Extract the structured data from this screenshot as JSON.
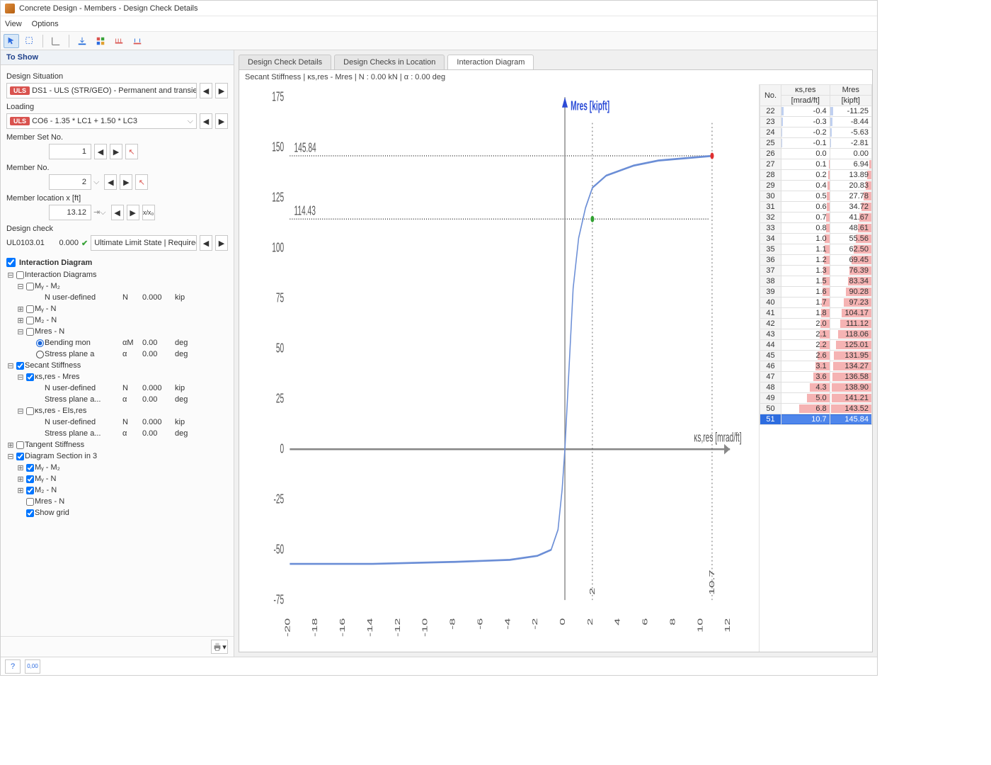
{
  "window_title": "Concrete Design - Members - Design Check Details",
  "menu": {
    "view": "View",
    "options": "Options"
  },
  "sidebar": {
    "header": "To Show",
    "design_situation_lbl": "Design Situation",
    "design_situation_badge": "ULS",
    "design_situation_val": "DS1 - ULS (STR/GEO) - Permanent and transient - E...",
    "loading_lbl": "Loading",
    "loading_badge": "ULS",
    "loading_val": "CO6 - 1.35 * LC1 + 1.50 * LC3",
    "member_set_lbl": "Member Set No.",
    "member_set_val": "1",
    "member_no_lbl": "Member No.",
    "member_no_val": "2",
    "member_loc_lbl": "Member location x [ft]",
    "member_loc_val": "13.12",
    "design_check_lbl": "Design check",
    "design_check_code": "UL0103.01",
    "design_check_ratio": "0.000",
    "design_check_desc": "Ultimate Limit State | Required...",
    "interaction_chk": "Interaction Diagram",
    "tree": [
      {
        "lvl": 0,
        "tw": "−",
        "ck": "u",
        "t1": "Interaction Diagrams"
      },
      {
        "lvl": 1,
        "tw": "−",
        "ck": "u",
        "t1": "Mᵧ - M₂"
      },
      {
        "lvl": 2,
        "tw": "",
        "ck": "",
        "t1": "N user-defined",
        "c2": "N",
        "c3": "0.000",
        "c4": "kip"
      },
      {
        "lvl": 1,
        "tw": "+",
        "ck": "u",
        "t1": "Mᵧ - N"
      },
      {
        "lvl": 1,
        "tw": "+",
        "ck": "u",
        "t1": "M₂ - N"
      },
      {
        "lvl": 1,
        "tw": "−",
        "ck": "u",
        "t1": "Mres - N"
      },
      {
        "lvl": 2,
        "tw": "",
        "ck": "r1",
        "t1": "Bending mon",
        "c2": "αM",
        "c3": "0.00",
        "c4": "deg"
      },
      {
        "lvl": 2,
        "tw": "",
        "ck": "r0",
        "t1": "Stress plane a",
        "c2": "α",
        "c3": "0.00",
        "c4": "deg"
      },
      {
        "lvl": 0,
        "tw": "−",
        "ck": "c",
        "t1": "Secant Stiffness"
      },
      {
        "lvl": 1,
        "tw": "−",
        "ck": "c",
        "t1": "κs,res - Mres"
      },
      {
        "lvl": 2,
        "tw": "",
        "ck": "",
        "t1": "N user-defined",
        "c2": "N",
        "c3": "0.000",
        "c4": "kip"
      },
      {
        "lvl": 2,
        "tw": "",
        "ck": "",
        "t1": "Stress plane a...",
        "c2": "α",
        "c3": "0.00",
        "c4": "deg"
      },
      {
        "lvl": 1,
        "tw": "−",
        "ck": "u",
        "t1": "κs,res - EIs,res"
      },
      {
        "lvl": 2,
        "tw": "",
        "ck": "",
        "t1": "N user-defined",
        "c2": "N",
        "c3": "0.000",
        "c4": "kip"
      },
      {
        "lvl": 2,
        "tw": "",
        "ck": "",
        "t1": "Stress plane a...",
        "c2": "α",
        "c3": "0.00",
        "c4": "deg"
      },
      {
        "lvl": 0,
        "tw": "+",
        "ck": "u",
        "t1": "Tangent Stiffness"
      },
      {
        "lvl": 0,
        "tw": "−",
        "ck": "c",
        "t1": "Diagram Section in 3"
      },
      {
        "lvl": 1,
        "tw": "+",
        "ck": "c",
        "t1": "Mᵧ - M₂"
      },
      {
        "lvl": 1,
        "tw": "+",
        "ck": "c",
        "t1": "Mᵧ - N"
      },
      {
        "lvl": 1,
        "tw": "+",
        "ck": "c",
        "t1": "M₂ - N"
      },
      {
        "lvl": 1,
        "tw": "",
        "ck": "u",
        "t1": "Mres - N"
      },
      {
        "lvl": 1,
        "tw": "",
        "ck": "c",
        "t1": "Show grid"
      }
    ]
  },
  "tabs": {
    "t1": "Design Check Details",
    "t2": "Design Checks in Location",
    "t3": "Interaction Diagram"
  },
  "chart_caption": "Secant Stiffness | κs,res - Mres | N : 0.00 kN | α : 0.00 deg",
  "chart_data": {
    "type": "line",
    "xlabel": "κs,res [mrad/ft]",
    "ylabel": "Mres [kipft]",
    "xlim": [
      -20,
      12
    ],
    "ylim": [
      -75,
      175
    ],
    "xticks": [
      -20,
      -18,
      -16,
      -14,
      -12,
      -10,
      -8,
      -6,
      -4,
      -2,
      0,
      2,
      4,
      6,
      8,
      10,
      12
    ],
    "yticks": [
      -75,
      -50,
      -25,
      0,
      25,
      50,
      75,
      100,
      125,
      150,
      175
    ],
    "annotations": [
      {
        "y": 145.84,
        "txt": "145.84"
      },
      {
        "y": 114.43,
        "txt": "114.43"
      }
    ],
    "marks": {
      "x1": 2.0,
      "x2": 10.7
    },
    "series": [
      {
        "name": "κ-M",
        "values": [
          [
            -20,
            -57
          ],
          [
            -14,
            -57
          ],
          [
            -8,
            -56
          ],
          [
            -6,
            -55.5
          ],
          [
            -4,
            -55
          ],
          [
            -2,
            -53
          ],
          [
            -1,
            -50
          ],
          [
            -0.5,
            -40
          ],
          [
            -0.2,
            -20
          ],
          [
            0,
            0
          ],
          [
            0.3,
            40
          ],
          [
            0.6,
            80
          ],
          [
            1.0,
            105
          ],
          [
            1.5,
            120
          ],
          [
            2.0,
            130
          ],
          [
            3,
            136
          ],
          [
            5,
            141
          ],
          [
            6.8,
            143.5
          ],
          [
            10.7,
            145.8
          ]
        ]
      }
    ],
    "points": [
      {
        "x": 10.7,
        "y": 145.84,
        "cls": "pt-red"
      },
      {
        "x": 2.0,
        "y": 114.43,
        "cls": "pt-grn"
      }
    ]
  },
  "table": {
    "cols": {
      "no": "No.",
      "k": "κs,res",
      "ku": "[mrad/ft]",
      "m": "Mres",
      "mu": "[kipft]"
    },
    "rows": [
      {
        "no": 22,
        "k": -0.4,
        "m": -11.25
      },
      {
        "no": 23,
        "k": -0.3,
        "m": -8.44
      },
      {
        "no": 24,
        "k": -0.2,
        "m": -5.63
      },
      {
        "no": 25,
        "k": -0.1,
        "m": -2.81
      },
      {
        "no": 26,
        "k": 0.0,
        "m": 0.0
      },
      {
        "no": 27,
        "k": 0.1,
        "m": 6.94
      },
      {
        "no": 28,
        "k": 0.2,
        "m": 13.89
      },
      {
        "no": 29,
        "k": 0.4,
        "m": 20.83
      },
      {
        "no": 30,
        "k": 0.5,
        "m": 27.78
      },
      {
        "no": 31,
        "k": 0.6,
        "m": 34.72
      },
      {
        "no": 32,
        "k": 0.7,
        "m": 41.67
      },
      {
        "no": 33,
        "k": 0.8,
        "m": 48.61
      },
      {
        "no": 34,
        "k": 1.0,
        "m": 55.56
      },
      {
        "no": 35,
        "k": 1.1,
        "m": 62.5
      },
      {
        "no": 36,
        "k": 1.2,
        "m": 69.45
      },
      {
        "no": 37,
        "k": 1.3,
        "m": 76.39
      },
      {
        "no": 38,
        "k": 1.5,
        "m": 83.34
      },
      {
        "no": 39,
        "k": 1.6,
        "m": 90.28
      },
      {
        "no": 40,
        "k": 1.7,
        "m": 97.23
      },
      {
        "no": 41,
        "k": 1.8,
        "m": 104.17
      },
      {
        "no": 42,
        "k": 2.0,
        "m": 111.12
      },
      {
        "no": 43,
        "k": 2.1,
        "m": 118.06
      },
      {
        "no": 44,
        "k": 2.2,
        "m": 125.01
      },
      {
        "no": 45,
        "k": 2.6,
        "m": 131.95
      },
      {
        "no": 46,
        "k": 3.1,
        "m": 134.27
      },
      {
        "no": 47,
        "k": 3.6,
        "m": 136.58
      },
      {
        "no": 48,
        "k": 4.3,
        "m": 138.9
      },
      {
        "no": 49,
        "k": 5.0,
        "m": 141.21
      },
      {
        "no": 50,
        "k": 6.8,
        "m": 143.52
      },
      {
        "no": 51,
        "k": 10.7,
        "m": 145.84,
        "sel": true
      }
    ]
  }
}
